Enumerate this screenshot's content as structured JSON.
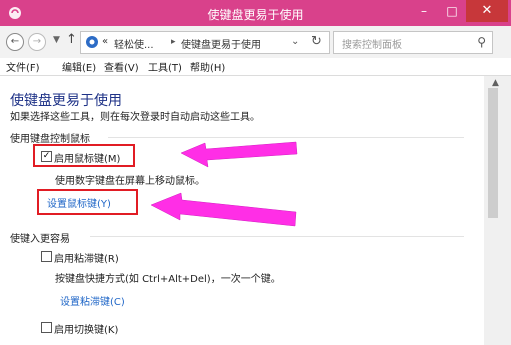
{
  "window": {
    "title": "使键盘更易于使用",
    "colors": {
      "titlebar": "#d9418b",
      "close": "#c7373a",
      "accent_link": "#1f66c7",
      "annotation_red": "#e11c24",
      "annotation_magenta": "#ff2ee6"
    }
  },
  "addressbar": {
    "breadcrumbs": [
      "«",
      "轻松使...",
      "使键盘更易于使用"
    ],
    "search_placeholder": "搜索控制面板"
  },
  "menubar": {
    "items": [
      "文件(F)",
      "编辑(E)",
      "查看(V)",
      "工具(T)",
      "帮助(H)"
    ]
  },
  "content": {
    "title": "使键盘更易于使用",
    "subtitle": "如果选择这些工具，则在每次登录时自动启动这些工具。",
    "group1": {
      "label": "使用键盘控制鼠标",
      "mouse_keys": {
        "label": "启用鼠标键(M)",
        "checked": true
      },
      "description": "使用数字键盘在屏幕上移动鼠标。",
      "link": "设置鼠标键(Y)"
    },
    "group2": {
      "label": "使键入更容易",
      "sticky_keys": {
        "label": "启用粘滞键(R)",
        "checked": false
      },
      "sticky_desc": "按键盘快捷方式(如 Ctrl+Alt+Del)，一次一个键。",
      "sticky_link": "设置粘滞键(C)",
      "toggle_keys": {
        "label": "启用切换键(K)",
        "checked": false
      }
    }
  }
}
